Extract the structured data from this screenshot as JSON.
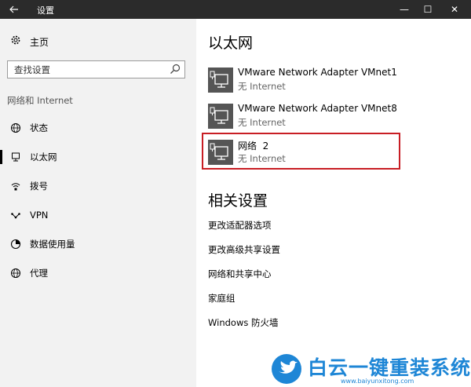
{
  "window": {
    "title": "设置",
    "back_icon": "back-arrow-icon",
    "minimize": "—",
    "maximize": "☐",
    "close": "✕"
  },
  "sidebar": {
    "home_label": "主页",
    "search_placeholder": "查找设置",
    "section_label": "网络和 Internet",
    "items": [
      {
        "label": "状态",
        "icon": "globe-status-icon"
      },
      {
        "label": "以太网",
        "icon": "ethernet-icon",
        "selected": true
      },
      {
        "label": "拨号",
        "icon": "dialup-icon"
      },
      {
        "label": "VPN",
        "icon": "vpn-icon"
      },
      {
        "label": "数据使用量",
        "icon": "data-usage-icon"
      },
      {
        "label": "代理",
        "icon": "proxy-globe-icon"
      }
    ]
  },
  "main": {
    "title": "以太网",
    "adapters": [
      {
        "name": "VMware Network Adapter VMnet1",
        "status": "无 Internet"
      },
      {
        "name": "VMware Network Adapter VMnet8",
        "status": "无 Internet"
      },
      {
        "name": "网络  2",
        "status": "无 Internet",
        "highlighted": true
      }
    ],
    "related_title": "相关设置",
    "links": [
      "更改适配器选项",
      "更改高级共享设置",
      "网络和共享中心",
      "家庭组",
      "Windows 防火墙"
    ]
  },
  "watermark": {
    "brand": "白云一键重装系统",
    "url": "www.baiyunxitong.com"
  },
  "colors": {
    "titlebar": "#2b2b2b",
    "sidebar": "#f2f2f2",
    "highlight": "#c81e24",
    "watermark": "#1e86d6"
  }
}
